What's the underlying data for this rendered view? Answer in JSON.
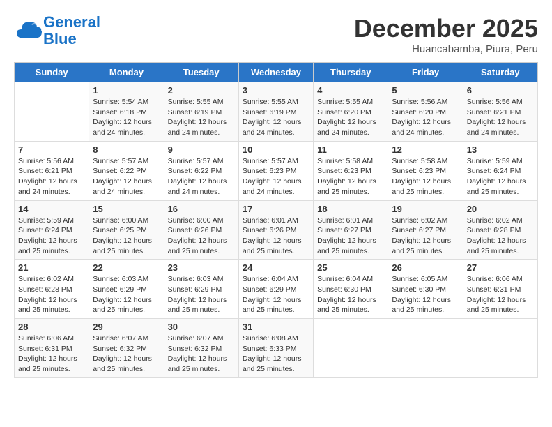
{
  "header": {
    "logo_line1": "General",
    "logo_line2": "Blue",
    "month": "December 2025",
    "location": "Huancabamba, Piura, Peru"
  },
  "days_of_week": [
    "Sunday",
    "Monday",
    "Tuesday",
    "Wednesday",
    "Thursday",
    "Friday",
    "Saturday"
  ],
  "weeks": [
    [
      {
        "day": "",
        "sunrise": "",
        "sunset": "",
        "daylight": ""
      },
      {
        "day": "1",
        "sunrise": "Sunrise: 5:54 AM",
        "sunset": "Sunset: 6:18 PM",
        "daylight": "Daylight: 12 hours and 24 minutes."
      },
      {
        "day": "2",
        "sunrise": "Sunrise: 5:55 AM",
        "sunset": "Sunset: 6:19 PM",
        "daylight": "Daylight: 12 hours and 24 minutes."
      },
      {
        "day": "3",
        "sunrise": "Sunrise: 5:55 AM",
        "sunset": "Sunset: 6:19 PM",
        "daylight": "Daylight: 12 hours and 24 minutes."
      },
      {
        "day": "4",
        "sunrise": "Sunrise: 5:55 AM",
        "sunset": "Sunset: 6:20 PM",
        "daylight": "Daylight: 12 hours and 24 minutes."
      },
      {
        "day": "5",
        "sunrise": "Sunrise: 5:56 AM",
        "sunset": "Sunset: 6:20 PM",
        "daylight": "Daylight: 12 hours and 24 minutes."
      },
      {
        "day": "6",
        "sunrise": "Sunrise: 5:56 AM",
        "sunset": "Sunset: 6:21 PM",
        "daylight": "Daylight: 12 hours and 24 minutes."
      }
    ],
    [
      {
        "day": "7",
        "sunrise": "Sunrise: 5:56 AM",
        "sunset": "Sunset: 6:21 PM",
        "daylight": "Daylight: 12 hours and 24 minutes."
      },
      {
        "day": "8",
        "sunrise": "Sunrise: 5:57 AM",
        "sunset": "Sunset: 6:22 PM",
        "daylight": "Daylight: 12 hours and 24 minutes."
      },
      {
        "day": "9",
        "sunrise": "Sunrise: 5:57 AM",
        "sunset": "Sunset: 6:22 PM",
        "daylight": "Daylight: 12 hours and 24 minutes."
      },
      {
        "day": "10",
        "sunrise": "Sunrise: 5:57 AM",
        "sunset": "Sunset: 6:23 PM",
        "daylight": "Daylight: 12 hours and 24 minutes."
      },
      {
        "day": "11",
        "sunrise": "Sunrise: 5:58 AM",
        "sunset": "Sunset: 6:23 PM",
        "daylight": "Daylight: 12 hours and 25 minutes."
      },
      {
        "day": "12",
        "sunrise": "Sunrise: 5:58 AM",
        "sunset": "Sunset: 6:23 PM",
        "daylight": "Daylight: 12 hours and 25 minutes."
      },
      {
        "day": "13",
        "sunrise": "Sunrise: 5:59 AM",
        "sunset": "Sunset: 6:24 PM",
        "daylight": "Daylight: 12 hours and 25 minutes."
      }
    ],
    [
      {
        "day": "14",
        "sunrise": "Sunrise: 5:59 AM",
        "sunset": "Sunset: 6:24 PM",
        "daylight": "Daylight: 12 hours and 25 minutes."
      },
      {
        "day": "15",
        "sunrise": "Sunrise: 6:00 AM",
        "sunset": "Sunset: 6:25 PM",
        "daylight": "Daylight: 12 hours and 25 minutes."
      },
      {
        "day": "16",
        "sunrise": "Sunrise: 6:00 AM",
        "sunset": "Sunset: 6:26 PM",
        "daylight": "Daylight: 12 hours and 25 minutes."
      },
      {
        "day": "17",
        "sunrise": "Sunrise: 6:01 AM",
        "sunset": "Sunset: 6:26 PM",
        "daylight": "Daylight: 12 hours and 25 minutes."
      },
      {
        "day": "18",
        "sunrise": "Sunrise: 6:01 AM",
        "sunset": "Sunset: 6:27 PM",
        "daylight": "Daylight: 12 hours and 25 minutes."
      },
      {
        "day": "19",
        "sunrise": "Sunrise: 6:02 AM",
        "sunset": "Sunset: 6:27 PM",
        "daylight": "Daylight: 12 hours and 25 minutes."
      },
      {
        "day": "20",
        "sunrise": "Sunrise: 6:02 AM",
        "sunset": "Sunset: 6:28 PM",
        "daylight": "Daylight: 12 hours and 25 minutes."
      }
    ],
    [
      {
        "day": "21",
        "sunrise": "Sunrise: 6:02 AM",
        "sunset": "Sunset: 6:28 PM",
        "daylight": "Daylight: 12 hours and 25 minutes."
      },
      {
        "day": "22",
        "sunrise": "Sunrise: 6:03 AM",
        "sunset": "Sunset: 6:29 PM",
        "daylight": "Daylight: 12 hours and 25 minutes."
      },
      {
        "day": "23",
        "sunrise": "Sunrise: 6:03 AM",
        "sunset": "Sunset: 6:29 PM",
        "daylight": "Daylight: 12 hours and 25 minutes."
      },
      {
        "day": "24",
        "sunrise": "Sunrise: 6:04 AM",
        "sunset": "Sunset: 6:29 PM",
        "daylight": "Daylight: 12 hours and 25 minutes."
      },
      {
        "day": "25",
        "sunrise": "Sunrise: 6:04 AM",
        "sunset": "Sunset: 6:30 PM",
        "daylight": "Daylight: 12 hours and 25 minutes."
      },
      {
        "day": "26",
        "sunrise": "Sunrise: 6:05 AM",
        "sunset": "Sunset: 6:30 PM",
        "daylight": "Daylight: 12 hours and 25 minutes."
      },
      {
        "day": "27",
        "sunrise": "Sunrise: 6:06 AM",
        "sunset": "Sunset: 6:31 PM",
        "daylight": "Daylight: 12 hours and 25 minutes."
      }
    ],
    [
      {
        "day": "28",
        "sunrise": "Sunrise: 6:06 AM",
        "sunset": "Sunset: 6:31 PM",
        "daylight": "Daylight: 12 hours and 25 minutes."
      },
      {
        "day": "29",
        "sunrise": "Sunrise: 6:07 AM",
        "sunset": "Sunset: 6:32 PM",
        "daylight": "Daylight: 12 hours and 25 minutes."
      },
      {
        "day": "30",
        "sunrise": "Sunrise: 6:07 AM",
        "sunset": "Sunset: 6:32 PM",
        "daylight": "Daylight: 12 hours and 25 minutes."
      },
      {
        "day": "31",
        "sunrise": "Sunrise: 6:08 AM",
        "sunset": "Sunset: 6:33 PM",
        "daylight": "Daylight: 12 hours and 25 minutes."
      },
      {
        "day": "",
        "sunrise": "",
        "sunset": "",
        "daylight": ""
      },
      {
        "day": "",
        "sunrise": "",
        "sunset": "",
        "daylight": ""
      },
      {
        "day": "",
        "sunrise": "",
        "sunset": "",
        "daylight": ""
      }
    ]
  ]
}
